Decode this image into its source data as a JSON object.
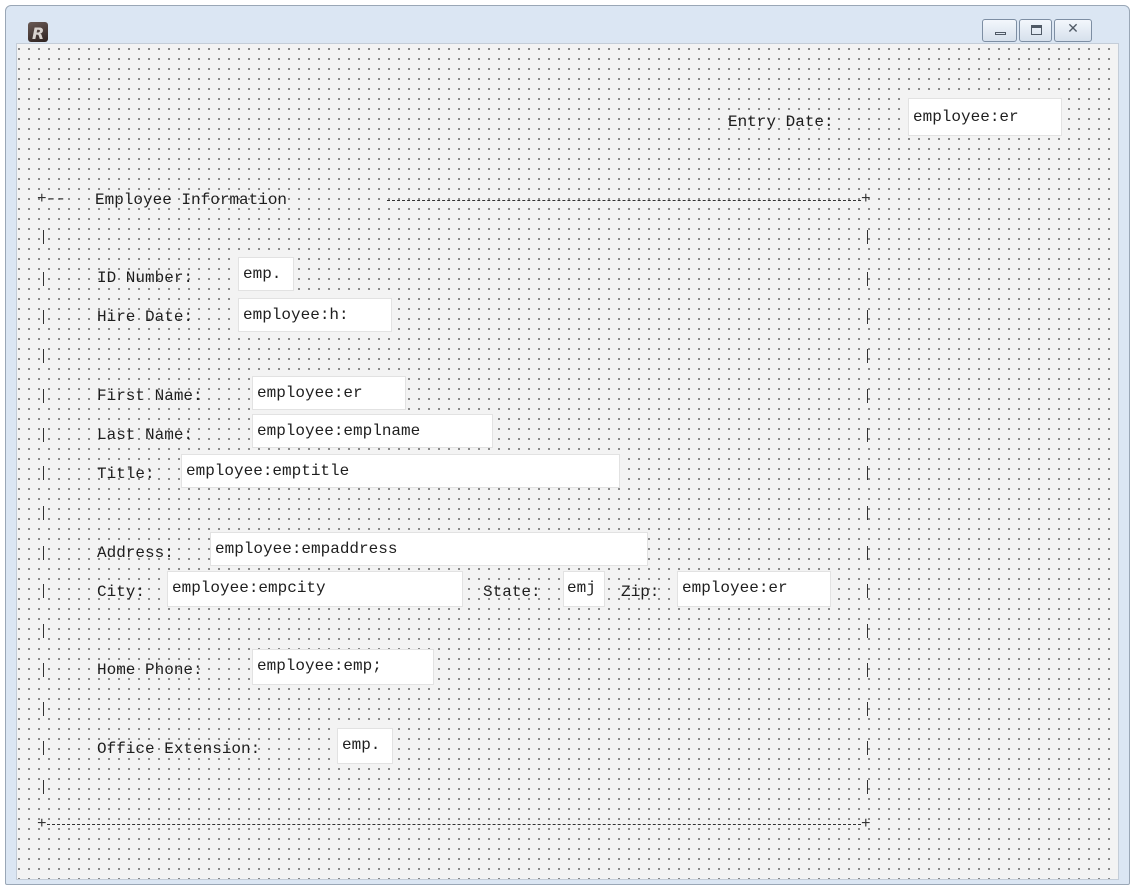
{
  "window": {
    "title": "",
    "controls": {
      "close_glyph": "✕"
    }
  },
  "form": {
    "entry_date": {
      "label": "Entry Date:",
      "value": "employee:er"
    },
    "group_title": "Employee Information",
    "id_number": {
      "label": "ID Number:",
      "value": "emp."
    },
    "hire_date": {
      "label": "Hire Date:",
      "value": "employee:h:"
    },
    "first_name": {
      "label": "First Name:",
      "value": "employee:er"
    },
    "last_name": {
      "label": "Last Name:",
      "value": "employee:emplname"
    },
    "title": {
      "label": "Title:",
      "value": "employee:emptitle"
    },
    "address": {
      "label": "Address:",
      "value": "employee:empaddress"
    },
    "city": {
      "label": "City:",
      "value": "employee:empcity"
    },
    "state": {
      "label": "State:",
      "value": "emj"
    },
    "zip": {
      "label": "Zip:",
      "value": "employee:er"
    },
    "home_phone": {
      "label": "Home Phone:",
      "value": "employee:emp;"
    },
    "office_extension": {
      "label": "Office Extension:",
      "value": "emp."
    }
  }
}
